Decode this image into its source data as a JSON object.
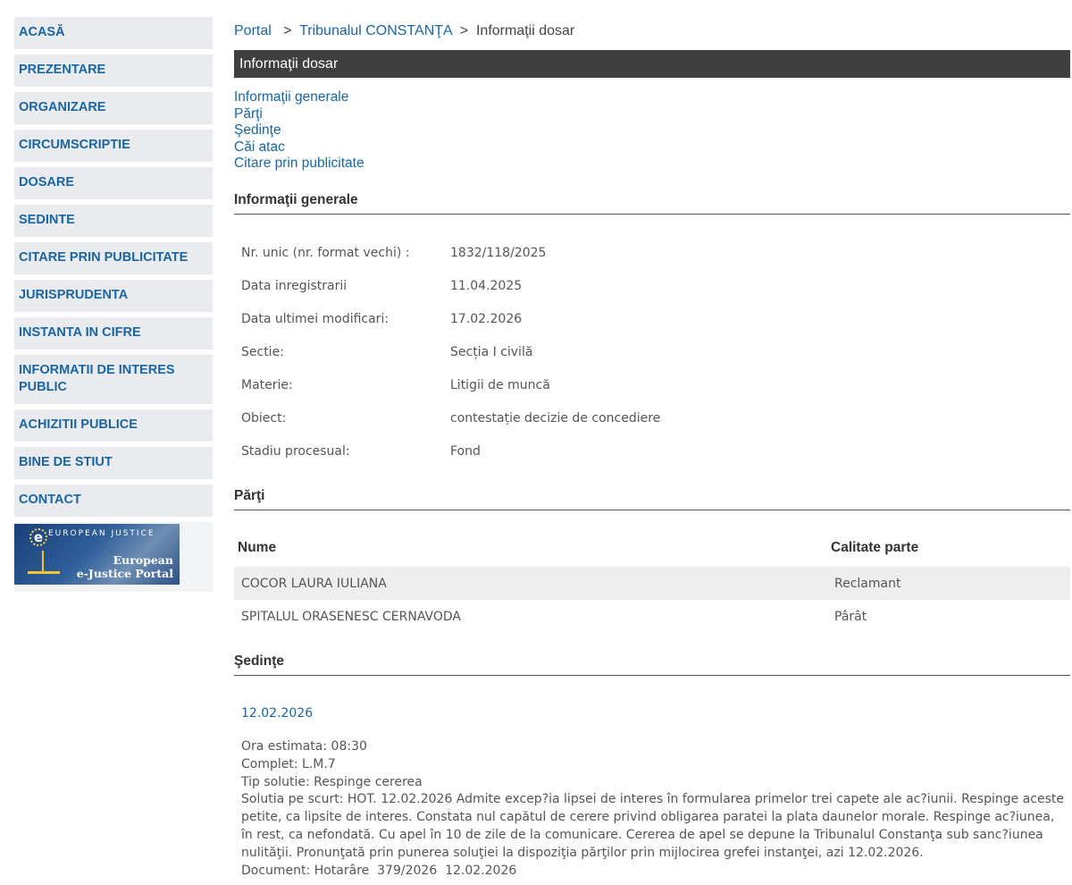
{
  "sidebar": {
    "items": [
      {
        "label": "ACASĂ"
      },
      {
        "label": "PREZENTARE"
      },
      {
        "label": "ORGANIZARE"
      },
      {
        "label": "CIRCUMSCRIPTIE"
      },
      {
        "label": "DOSARE"
      },
      {
        "label": "SEDINTE"
      },
      {
        "label": "CITARE PRIN PUBLICITATE"
      },
      {
        "label": "JURISPRUDENTA"
      },
      {
        "label": "INSTANTA IN CIFRE"
      },
      {
        "label": "INFORMATII DE INTERES PUBLIC"
      },
      {
        "label": "ACHIZITII PUBLICE"
      },
      {
        "label": "BINE DE STIUT"
      },
      {
        "label": "CONTACT"
      }
    ],
    "banner": {
      "top_text": "EUROPEAN JUSTICE",
      "line1": "European",
      "line2": "e-Justice Portal"
    }
  },
  "breadcrumb": {
    "portal": "Portal",
    "court": "Tribunalul CONSTANŢA",
    "current": "Informaţii dosar",
    "sep": ">"
  },
  "header": {
    "title": "Informaţii dosar"
  },
  "section_links": [
    {
      "label": "Informaţii generale"
    },
    {
      "label": "Părţi"
    },
    {
      "label": "Şedinţe"
    },
    {
      "label": "Căi atac"
    },
    {
      "label": "Citare prin publicitate"
    }
  ],
  "general": {
    "title": "Informaţii generale",
    "rows": [
      {
        "label": "Nr. unic (nr. format vechi) :",
        "value": "1832/118/2025"
      },
      {
        "label": "Data inregistrarii",
        "value": "11.04.2025"
      },
      {
        "label": "Data ultimei modificari:",
        "value": "17.02.2026"
      },
      {
        "label": "Sectie:",
        "value": "Secția I civilă"
      },
      {
        "label": "Materie:",
        "value": "Litigii de muncă"
      },
      {
        "label": "Obiect:",
        "value": "contestație decizie de concediere"
      },
      {
        "label": "Stadiu procesual:",
        "value": "Fond"
      }
    ]
  },
  "parties": {
    "title": "Părţi",
    "columns": [
      "Nume",
      "Calitate parte"
    ],
    "rows": [
      {
        "name": "COCOR LAURA IULIANA",
        "role": "Reclamant"
      },
      {
        "name": "SPITALUL ORASENESC CERNAVODA",
        "role": "Pârât"
      }
    ]
  },
  "hearings": {
    "title": "Şedinţe",
    "date": "12.02.2026",
    "lines": [
      "Ora estimata: 08:30",
      "Complet: L.M.7",
      "Tip solutie: Respinge cererea",
      "Solutia pe scurt: HOT. 12.02.2026 Admite excep?ia lipsei de interes în formularea primelor trei capete ale ac?iunii. Respinge aceste petite, ca lipsite de interes. Constata nul capătul de cerere privind obligarea paratei la plata daunelor morale. Respinge ac?iunea, în rest, ca nefondată. Cu apel în 10 de zile de la comunicare. Cererea de apel se depune la Tribunalul Constanţa sub sanc?iunea nulităţii. Pronunţată prin punerea soluţiei la dispoziţia părţilor prin mijlocirea grefei instanţei, azi 12.02.2026.",
      "Document: Hotarâre  379/2026  12.02.2026"
    ]
  },
  "colors": {
    "link": "#1a66a3",
    "header_bg": "#3f3f3f",
    "sidebar_bg": "#e9ebee",
    "row_shade": "#eeeeee"
  }
}
